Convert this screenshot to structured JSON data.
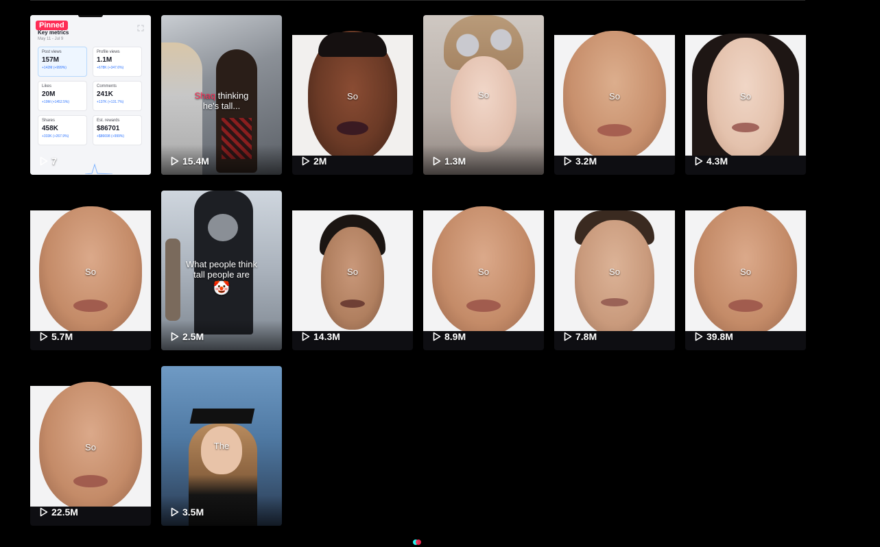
{
  "tiles": [
    {
      "kind": "metrics",
      "views": "7",
      "pinned_label": "Pinned",
      "metrics": {
        "title": "Key metrics",
        "date_range": "May 11 - Jul 9",
        "cards": [
          {
            "label": "Post views",
            "value": "157M",
            "delta": "+142M (+999%)",
            "active": true
          },
          {
            "label": "Profile views",
            "value": "1.1M",
            "delta": "+678K (+347.6%)"
          },
          {
            "label": "Likes",
            "value": "20M",
            "delta": "+19M (+1452.5%)"
          },
          {
            "label": "Comments",
            "value": "241K",
            "delta": "+137K (+131.7%)"
          },
          {
            "label": "Shares",
            "value": "458K",
            "delta": "+333K (+267.9%)"
          },
          {
            "label": "Est. rewards",
            "value": "$86701",
            "delta": "+$86698 (+999%)"
          }
        ]
      }
    },
    {
      "kind": "full",
      "views": "15.4M",
      "caption_red": "Shaq",
      "caption_white": "thinking",
      "caption_line2": "he's tall...",
      "bg": "#6a6e74"
    },
    {
      "kind": "portrait",
      "views": "2M",
      "caption": "So",
      "skin": "#6b3a26",
      "bg": "#f2f0ee"
    },
    {
      "kind": "full",
      "views": "1.3M",
      "caption": "So",
      "bg": "#b9b2ae",
      "skin": "#e9c8b8"
    },
    {
      "kind": "portrait",
      "views": "3.2M",
      "caption": "So",
      "skin": "#c8906d",
      "bg": "#f3f3f4"
    },
    {
      "kind": "portrait",
      "views": "4.3M",
      "caption": "So",
      "skin": "#e4c2ad",
      "bg": "#f3f3f4"
    },
    {
      "kind": "portrait",
      "views": "5.7M",
      "caption": "So",
      "skin": "#c48b68",
      "bg": "#f3f3f4"
    },
    {
      "kind": "full",
      "views": "2.5M",
      "caption_line1": "What people think",
      "caption_line2": "tall people are",
      "emoji": "🤡",
      "bg": "#9aa0a8"
    },
    {
      "kind": "portrait",
      "views": "14.3M",
      "caption": "So",
      "skin": "#b07f5f",
      "bg": "#f3f3f4"
    },
    {
      "kind": "portrait",
      "views": "8.9M",
      "caption": "So",
      "skin": "#c48b68",
      "bg": "#f3f3f4"
    },
    {
      "kind": "portrait",
      "views": "7.8M",
      "caption": "So",
      "skin": "#c99a7c",
      "bg": "#f3f3f4"
    },
    {
      "kind": "portrait",
      "views": "39.8M",
      "caption": "So",
      "skin": "#c48b68",
      "bg": "#f3f3f4"
    },
    {
      "kind": "portrait",
      "views": "22.5M",
      "caption": "So",
      "skin": "#c48b68",
      "bg": "#f3f3f4"
    },
    {
      "kind": "full",
      "views": "3.5M",
      "caption": "The",
      "bg": "#5f86b0"
    }
  ],
  "icons": {
    "play": "play-icon",
    "expand": "expand-icon",
    "loader": "loading-spinner-icon"
  },
  "colors": {
    "page_bg": "#000000",
    "pinned_badge": "#fe2c55",
    "loader_cyan": "#25f4ee",
    "loader_red": "#fe2c55"
  }
}
